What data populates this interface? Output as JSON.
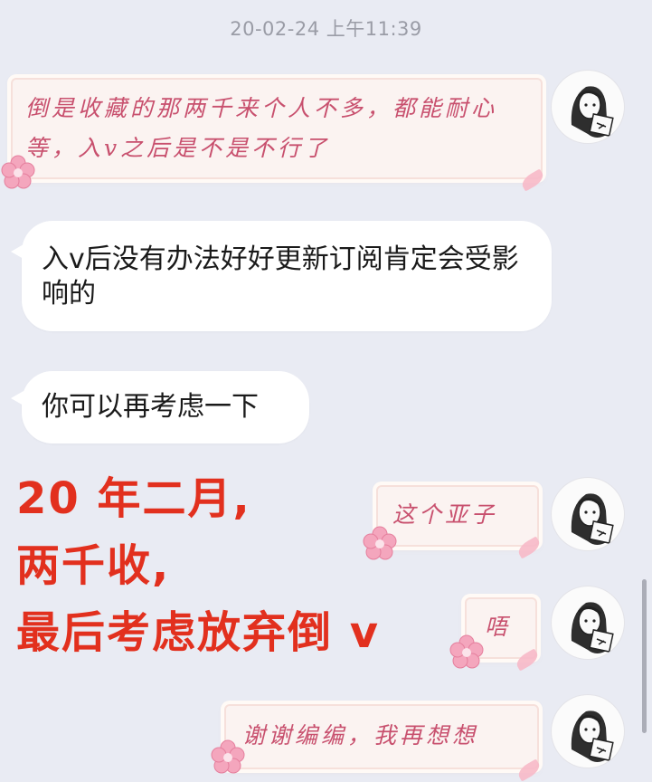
{
  "header": {
    "timestamp": "20-02-24 上午11:39"
  },
  "messages": [
    {
      "side": "out",
      "text": "倒是收藏的那两千来个人不多，都能耐心等，入v之后是不是不行了"
    },
    {
      "side": "in",
      "text": "入v后没有办法好好更新订阅肯定会受影响的"
    },
    {
      "side": "in",
      "text": "你可以再考虑一下"
    },
    {
      "side": "out",
      "text": "这个亚子"
    },
    {
      "side": "out",
      "text": "唔"
    },
    {
      "side": "out",
      "text": "谢谢编编，我再想想"
    }
  ],
  "overlay": {
    "line1": "20 年二月,",
    "line2": "两千收,",
    "line3": "最后考虑放弃倒 v"
  },
  "colors": {
    "background": "#e9ebf3",
    "overlay_text": "#e2301e",
    "sent_text": "#c8506e",
    "sent_bubble": "#fbf3f1"
  },
  "icons": [
    "avatar-ink-portrait-icon",
    "flower-decoration-icon"
  ]
}
